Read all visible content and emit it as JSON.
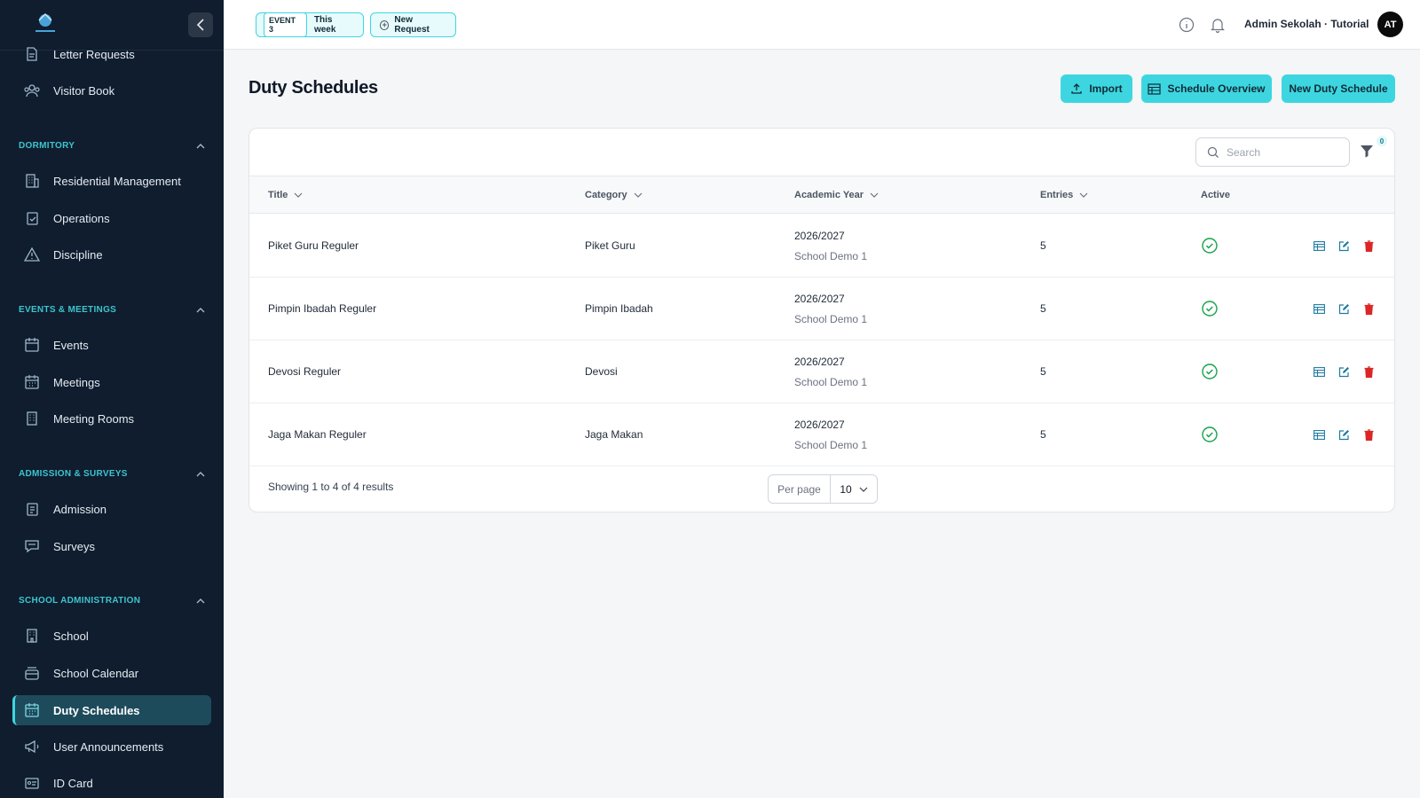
{
  "sidebar": {
    "items_top": [
      {
        "label": "Letter Requests",
        "icon": "document-icon"
      },
      {
        "label": "Visitor Book",
        "icon": "users-icon"
      }
    ],
    "sections": [
      {
        "title": "DORMITORY",
        "items": [
          {
            "label": "Residential Management",
            "icon": "building-icon"
          },
          {
            "label": "Operations",
            "icon": "clipboard-check-icon"
          },
          {
            "label": "Discipline",
            "icon": "warning-icon"
          }
        ]
      },
      {
        "title": "EVENTS & MEETINGS",
        "items": [
          {
            "label": "Events",
            "icon": "calendar-icon"
          },
          {
            "label": "Meetings",
            "icon": "calendar-grid-icon"
          },
          {
            "label": "Meeting Rooms",
            "icon": "building-icon"
          }
        ]
      },
      {
        "title": "ADMISSION & SURVEYS",
        "items": [
          {
            "label": "Admission",
            "icon": "clipboard-list-icon"
          },
          {
            "label": "Surveys",
            "icon": "chat-icon"
          }
        ]
      },
      {
        "title": "SCHOOL ADMINISTRATION",
        "items": [
          {
            "label": "School",
            "icon": "building-icon"
          },
          {
            "label": "School Calendar",
            "icon": "calendar-stack-icon"
          },
          {
            "label": "Duty Schedules",
            "icon": "calendar-grid-icon",
            "active": true
          },
          {
            "label": "User Announcements",
            "icon": "megaphone-icon"
          },
          {
            "label": "ID Card",
            "icon": "id-card-icon"
          }
        ]
      }
    ]
  },
  "topbar": {
    "event_tag": "EVENT 3",
    "event_label": "This week",
    "new_request": "New Request",
    "user_name": "Admin Sekolah · Tutorial",
    "avatar_initials": "AT"
  },
  "page": {
    "title": "Duty Schedules",
    "buttons": {
      "import": "Import",
      "overview": "Schedule Overview",
      "new": "New Duty Schedule"
    },
    "search_placeholder": "Search",
    "filter_count": "0"
  },
  "table": {
    "columns": [
      "Title",
      "Category",
      "Academic Year",
      "Entries",
      "Active"
    ],
    "rows": [
      {
        "title": "Piket Guru Reguler",
        "category": "Piket Guru",
        "year": "2026/2027",
        "school": "School Demo 1",
        "entries": "5"
      },
      {
        "title": "Pimpin Ibadah Reguler",
        "category": "Pimpin Ibadah",
        "year": "2026/2027",
        "school": "School Demo 1",
        "entries": "5"
      },
      {
        "title": "Devosi Reguler",
        "category": "Devosi",
        "year": "2026/2027",
        "school": "School Demo 1",
        "entries": "5"
      },
      {
        "title": "Jaga Makan Reguler",
        "category": "Jaga Makan",
        "year": "2026/2027",
        "school": "School Demo 1",
        "entries": "5"
      }
    ]
  },
  "footer": {
    "showing": "Showing 1 to 4 of 4 results",
    "per_page_label": "Per page",
    "per_page_value": "10"
  },
  "colors": {
    "sidebar_bg": "#0f1d2e",
    "accent": "#3dd6e0",
    "active_green": "#16a34a",
    "delete_red": "#dc2626"
  }
}
